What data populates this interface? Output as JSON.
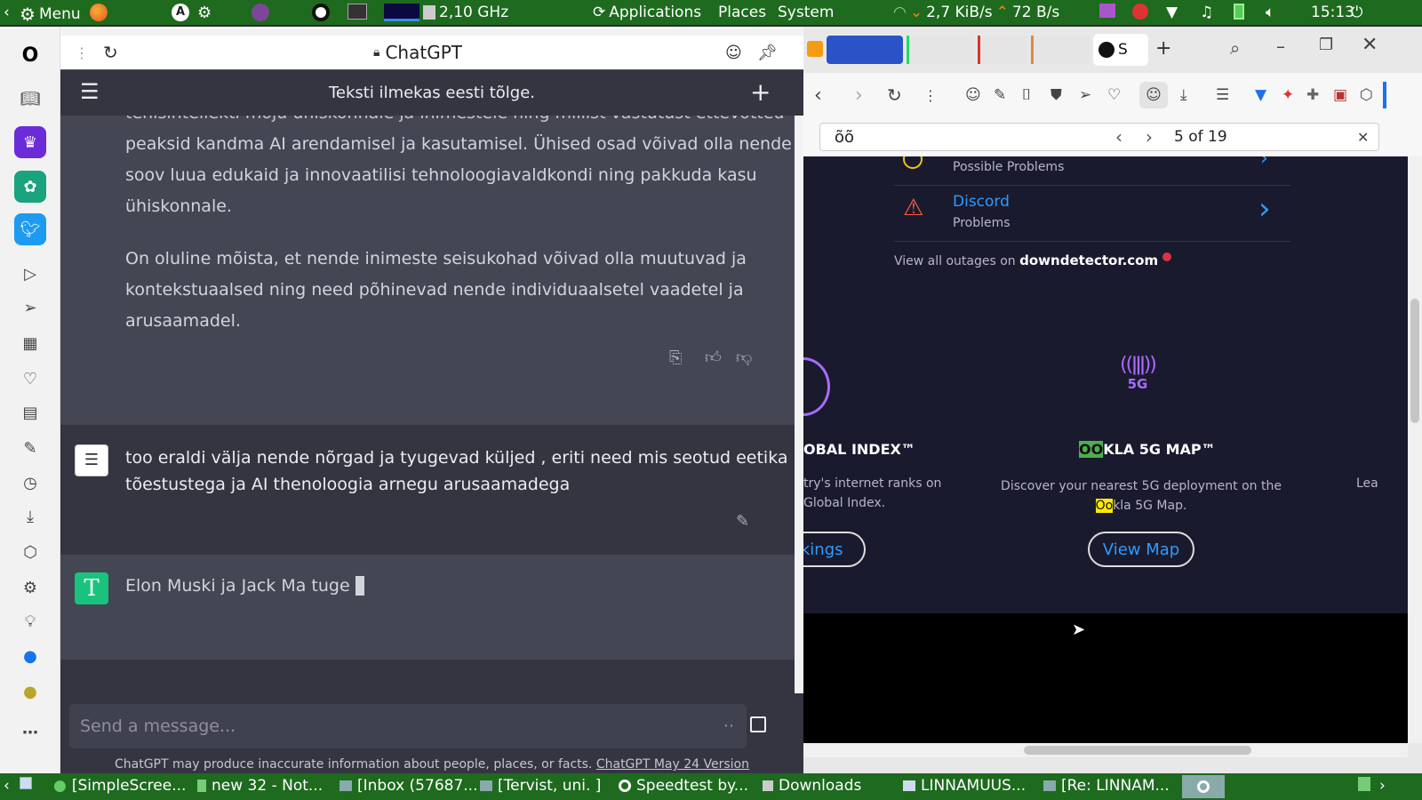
{
  "topbar": {
    "menu_label": "Menu",
    "cpu_freq": "2,10 GHz",
    "applications": "Applications",
    "places": "Places",
    "system": "System",
    "net_down": "2,7 KiB/s",
    "net_up": "72 B/s",
    "clock": "15:13"
  },
  "chat_header": {
    "site_title": "ChatGPT",
    "conversation_title": "Teksti ilmekas eesti tõlge."
  },
  "messages": {
    "ai_partial_line": "tehisintellekti mõju ühiskonnale ja inimestele ning millist vastutust ettevõtted",
    "ai_para1_l1": "peaksid kandma AI arendamisel ja kasutamisel. Ühised osad võivad olla nende",
    "ai_para1_l2": "soov luua edukaid ja innovaatilisi tehnoloogiavaldkondi ning pakkuda kasu",
    "ai_para1_l3": "ühiskonnale.",
    "ai_para2_l1": "On oluline mõista, et nende inimeste seisukohad võivad olla muutuvad ja",
    "ai_para2_l2": "kontekstuaalsed ning need põhinevad nende individuaalsetel vaadetel ja",
    "ai_para2_l3": "arusaamadel.",
    "user_l1": "too eraldi välja nende nõrgad ja tyugevad küljed , eriti need mis seotud eetika",
    "user_l2": "tõestustega ja AI thenoloogia arnegu arusaamadega",
    "ai_streaming": "Elon Muski ja Jack Ma tuge",
    "ai_avatar_letter": "T"
  },
  "composer": {
    "placeholder": "Send a message...",
    "disclaimer": "ChatGPT may produce inaccurate information about people, places, or facts.",
    "version_link": "ChatGPT May 24 Version"
  },
  "find_bar": {
    "query": "õõ",
    "count": "5 of 19"
  },
  "page": {
    "item1_sub": "Possible Problems",
    "item2_title": "Discord",
    "item2_sub": "Problems",
    "view_all_prefix": "View all outages on",
    "view_all_site": "downdetector.com",
    "card1_title": "OBAL INDEX™",
    "card1_l1": "try's internet ranks on",
    "card1_l2": "Global Index.",
    "card1_btn": "nkings",
    "card2_icon_label": "5G",
    "card2_title_hl": "OO",
    "card2_title_rest": "KLA 5G MAP™",
    "card2_l1": "Discover your nearest 5G deployment on the",
    "card2_l2_hl": "Oo",
    "card2_l2_rest": "kla 5G Map.",
    "card2_btn": "View Map",
    "card3_partial": "Lea"
  },
  "tabs": {
    "active_letter": "S"
  },
  "taskbar": {
    "t1": "[SimpleScree...",
    "t2": "new 32 - Not...",
    "t3": "[Inbox (57687...",
    "t4": "[Tervist, uni. ]",
    "t5": "Speedtest by...",
    "t6": "Downloads",
    "t7": "LINNAMUUS...",
    "t8": "[Re: LINNAM..."
  }
}
